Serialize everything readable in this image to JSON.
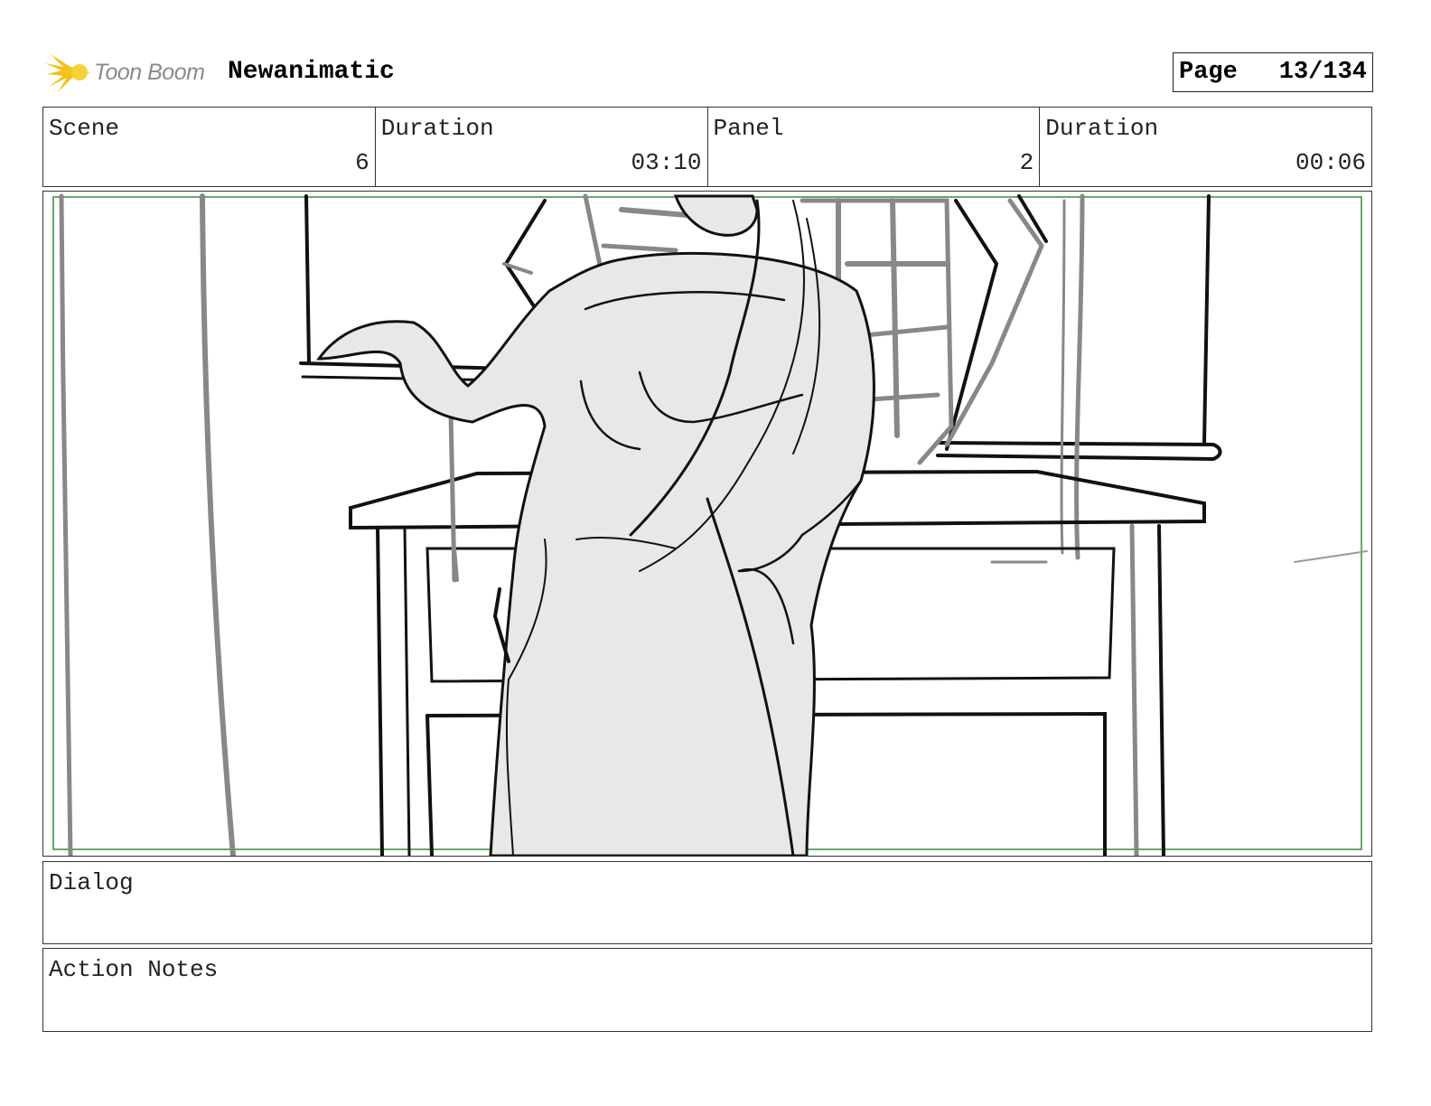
{
  "header": {
    "logo_text": "Toon Boom",
    "project_title": "Newanimatic",
    "page_label": "Page",
    "page_number": "13/134"
  },
  "info": {
    "scene_label": "Scene",
    "scene_value": "6",
    "scene_duration_label": "Duration",
    "scene_duration_value": "03:10",
    "panel_label": "Panel",
    "panel_value": "2",
    "panel_duration_label": "Duration",
    "panel_duration_value": "00:06"
  },
  "dialog": {
    "label": "Dialog",
    "text": ""
  },
  "action_notes": {
    "label": "Action Notes",
    "text": ""
  },
  "colors": {
    "safe_frame": "#3a8a3a",
    "logo_accent": "#f2c318",
    "figure_fill": "#e8e8e8"
  }
}
